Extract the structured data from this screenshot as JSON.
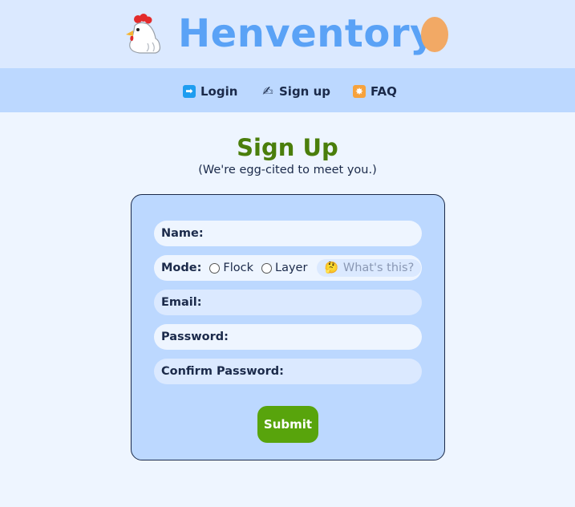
{
  "header": {
    "brand_title": "Henventory",
    "logo_icon": "chicken-icon",
    "egg_icon": "egg-icon"
  },
  "nav": {
    "items": [
      {
        "label": "Login",
        "icon": "login-arrow-icon"
      },
      {
        "label": "Sign up",
        "icon": "writing-hand-icon"
      },
      {
        "label": "FAQ",
        "icon": "star-burst-icon"
      }
    ]
  },
  "main": {
    "title": "Sign Up",
    "subtitle": "(We're egg-cited to meet you.)"
  },
  "form": {
    "name_label": "Name:",
    "mode_label": "Mode:",
    "mode_options": [
      "Flock",
      "Layer"
    ],
    "whats_this": "What's this?",
    "email_label": "Email:",
    "password_label": "Password:",
    "confirm_label": "Confirm Password:",
    "submit_label": "Submit"
  },
  "colors": {
    "brand": "#5aa2f6",
    "title_green": "#4a7e0b",
    "submit_green": "#58a40c",
    "nav_bg": "#bcd8ff",
    "header_bg": "#dbe9ff",
    "page_bg": "#eef5ff"
  }
}
